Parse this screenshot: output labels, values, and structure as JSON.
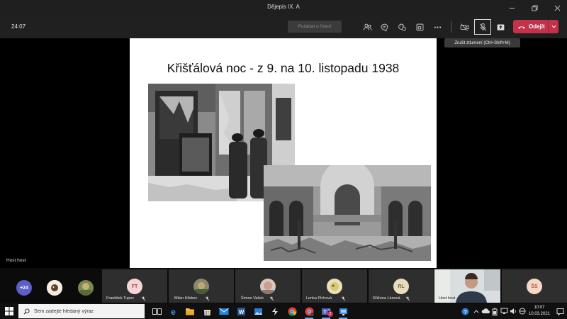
{
  "window": {
    "title": "Dějepis IX. A",
    "controls": [
      "minimize-icon",
      "restore-icon",
      "close-icon"
    ]
  },
  "toolbar": {
    "timer": "24:07",
    "raise_hand_label": "Požádat o řízení",
    "buttons": [
      "participants-icon",
      "chat-icon",
      "reactions-icon",
      "rooms-icon",
      "more-icon",
      "camera-off-icon",
      "mic-off-icon",
      "share-icon"
    ],
    "leave_label": "Odejít",
    "leave_color": "#c4314b"
  },
  "tooltip": {
    "text": "Zrušit ztlumení (Ctrl+Shift+M)"
  },
  "slide": {
    "title": "Křišťálová noc - z 9. na 10. listopadu 1938"
  },
  "stage": {
    "presenter_label": "Host host"
  },
  "participants": [
    {
      "kind": "count",
      "label": "+24",
      "color": "#5b5fc7"
    },
    {
      "kind": "photo",
      "label": ""
    },
    {
      "kind": "photo",
      "label": ""
    },
    {
      "kind": "initials",
      "initials": "FT",
      "name": "František Tupec",
      "color": "#f4d6d6"
    },
    {
      "kind": "photo",
      "initials": "",
      "name": "Milan Hřebec"
    },
    {
      "kind": "photo",
      "initials": "",
      "name": "Šimon Vašek"
    },
    {
      "kind": "photo",
      "initials": "",
      "name": "Lenka Plchová"
    },
    {
      "kind": "initials",
      "initials": "RL",
      "name": "Růžena Lánová",
      "color": "#e8dcc0"
    },
    {
      "kind": "video",
      "name": "Host host"
    },
    {
      "kind": "initials",
      "initials": "ŠS",
      "name": "",
      "color": "#f6d8c6"
    }
  ],
  "taskbar": {
    "search_placeholder": "Sem zadejte hledaný výraz",
    "teams_badge": "2",
    "time": "10:07",
    "date": "10.03.2021"
  }
}
